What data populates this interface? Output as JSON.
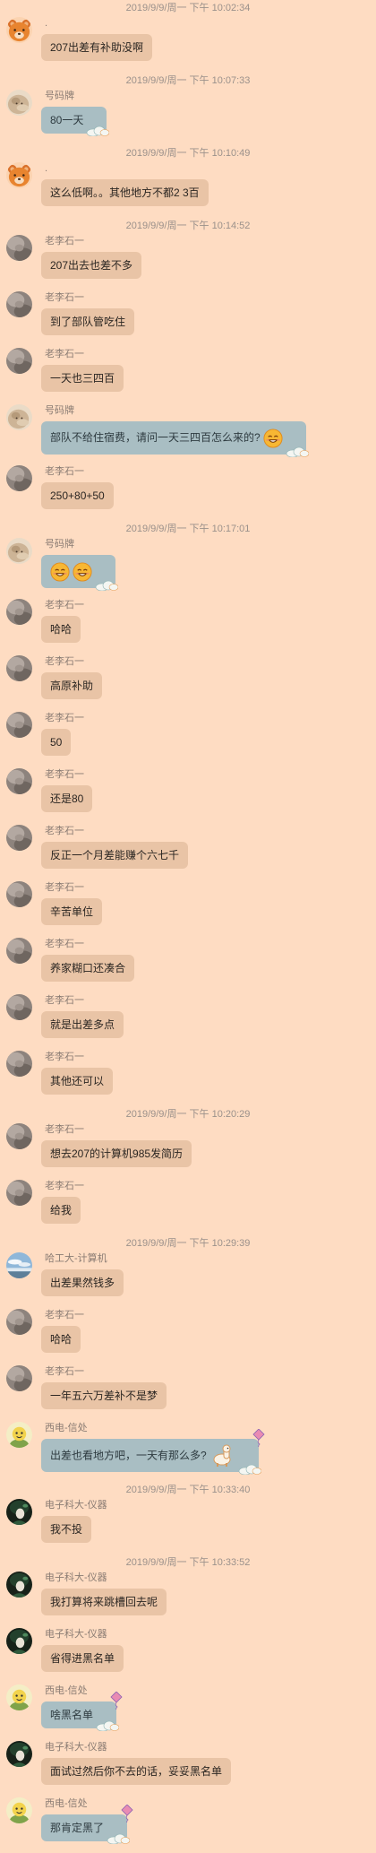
{
  "colors": {
    "background": "#fedcc2",
    "bubble": "#e9c4a6",
    "themed_bubble": "#a9bec3",
    "timestamp_text": "#9b918b",
    "sender_text": "#8a7c73"
  },
  "chat": {
    "items": [
      {
        "kind": "timestamp",
        "text": "2019/9/9/周一 下午 10:02:34"
      },
      {
        "kind": "message",
        "sender": ".",
        "avatar": "bear-avatar",
        "bubble": "plain",
        "text": "207出差有补助没啊"
      },
      {
        "kind": "timestamp",
        "text": "2019/9/9/周一 下午 10:07:33"
      },
      {
        "kind": "message",
        "sender": "号码牌",
        "avatar": "fluffy-dog-avatar",
        "bubble": "blue-cloud",
        "text": "80一天"
      },
      {
        "kind": "timestamp",
        "text": "2019/9/9/周一 下午 10:10:49"
      },
      {
        "kind": "message",
        "sender": ".",
        "avatar": "bear-avatar",
        "bubble": "plain",
        "text": "这么低啊。。其他地方不都2 3百"
      },
      {
        "kind": "timestamp",
        "text": "2019/9/9/周一 下午 10:14:52"
      },
      {
        "kind": "message",
        "sender": "老李石一",
        "avatar": "gray-photo-avatar",
        "bubble": "plain",
        "text": "207出去也差不多"
      },
      {
        "kind": "message",
        "sender": "老李石一",
        "avatar": "gray-photo-avatar",
        "bubble": "plain",
        "text": "到了部队管吃住"
      },
      {
        "kind": "message",
        "sender": "老李石一",
        "avatar": "gray-photo-avatar",
        "bubble": "plain",
        "text": "一天也三四百"
      },
      {
        "kind": "message",
        "sender": "号码牌",
        "avatar": "fluffy-dog-avatar",
        "bubble": "blue-cloud",
        "text": "部队不给住宿费，请问一天三四百怎么来的?",
        "emoji": [
          "smile-emoji-icon"
        ]
      },
      {
        "kind": "message",
        "sender": "老李石一",
        "avatar": "gray-photo-avatar",
        "bubble": "plain",
        "text": "250+80+50"
      },
      {
        "kind": "timestamp",
        "text": "2019/9/9/周一 下午 10:17:01"
      },
      {
        "kind": "message",
        "sender": "号码牌",
        "avatar": "fluffy-dog-avatar",
        "bubble": "blue-cloud",
        "emoji": [
          "smile-emoji-icon",
          "smile-emoji-icon"
        ]
      },
      {
        "kind": "message",
        "sender": "老李石一",
        "avatar": "gray-photo-avatar",
        "bubble": "plain",
        "text": "哈哈"
      },
      {
        "kind": "message",
        "sender": "老李石一",
        "avatar": "gray-photo-avatar",
        "bubble": "plain",
        "text": "高原补助"
      },
      {
        "kind": "message",
        "sender": "老李石一",
        "avatar": "gray-photo-avatar",
        "bubble": "plain",
        "text": "50"
      },
      {
        "kind": "message",
        "sender": "老李石一",
        "avatar": "gray-photo-avatar",
        "bubble": "plain",
        "text": "还是80"
      },
      {
        "kind": "message",
        "sender": "老李石一",
        "avatar": "gray-photo-avatar",
        "bubble": "plain",
        "text": "反正一个月差能赚个六七千"
      },
      {
        "kind": "message",
        "sender": "老李石一",
        "avatar": "gray-photo-avatar",
        "bubble": "plain",
        "text": "辛苦单位"
      },
      {
        "kind": "message",
        "sender": "老李石一",
        "avatar": "gray-photo-avatar",
        "bubble": "plain",
        "text": "养家糊口还凑合"
      },
      {
        "kind": "message",
        "sender": "老李石一",
        "avatar": "gray-photo-avatar",
        "bubble": "plain",
        "text": "就是出差多点"
      },
      {
        "kind": "message",
        "sender": "老李石一",
        "avatar": "gray-photo-avatar",
        "bubble": "plain",
        "text": "其他还可以"
      },
      {
        "kind": "timestamp",
        "text": "2019/9/9/周一 下午 10:20:29"
      },
      {
        "kind": "message",
        "sender": "老李石一",
        "avatar": "gray-photo-avatar",
        "bubble": "plain",
        "text": "想去207的计算机985发简历"
      },
      {
        "kind": "message",
        "sender": "老李石一",
        "avatar": "gray-photo-avatar",
        "bubble": "plain",
        "text": "给我"
      },
      {
        "kind": "timestamp",
        "text": "2019/9/9/周一 下午 10:29:39"
      },
      {
        "kind": "message",
        "sender": "哈工大-计算机",
        "avatar": "landscape-avatar",
        "bubble": "plain",
        "text": "出差果然钱多"
      },
      {
        "kind": "message",
        "sender": "老李石一",
        "avatar": "gray-photo-avatar",
        "bubble": "plain",
        "text": "哈哈"
      },
      {
        "kind": "message",
        "sender": "老李石一",
        "avatar": "gray-photo-avatar",
        "bubble": "plain",
        "text": "一年五六万差补不是梦"
      },
      {
        "kind": "message",
        "sender": "西电-信处",
        "avatar": "yellow-cartoon-avatar",
        "bubble": "blue-kite",
        "text": "出差也看地方吧，一天有那么多?",
        "sticker": "alpaca-sticker-icon"
      },
      {
        "kind": "timestamp",
        "text": "2019/9/9/周一 下午 10:33:40"
      },
      {
        "kind": "message",
        "sender": "电子科大-仪器",
        "avatar": "dark-anime-avatar",
        "bubble": "plain",
        "text": "我不投"
      },
      {
        "kind": "timestamp",
        "text": "2019/9/9/周一 下午 10:33:52"
      },
      {
        "kind": "message",
        "sender": "电子科大-仪器",
        "avatar": "dark-anime-avatar",
        "bubble": "plain",
        "text": "我打算将来跳槽回去呢"
      },
      {
        "kind": "message",
        "sender": "电子科大-仪器",
        "avatar": "dark-anime-avatar",
        "bubble": "plain",
        "text": "省得进黑名单"
      },
      {
        "kind": "message",
        "sender": "西电-信处",
        "avatar": "yellow-cartoon-avatar",
        "bubble": "blue-kite",
        "text": "啥黑名单"
      },
      {
        "kind": "message",
        "sender": "电子科大-仪器",
        "avatar": "dark-anime-avatar",
        "bubble": "plain",
        "text": "面试过然后你不去的话，妥妥黑名单"
      },
      {
        "kind": "message",
        "sender": "西电-信处",
        "avatar": "yellow-cartoon-avatar",
        "bubble": "blue-kite",
        "text": "那肯定黑了"
      }
    ]
  }
}
